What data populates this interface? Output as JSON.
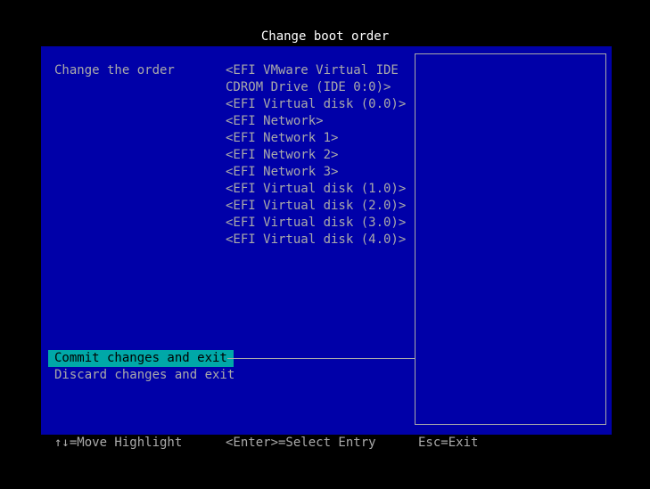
{
  "title": "Change boot order",
  "field_label": "Change the order",
  "boot_entries": [
    "<EFI VMware Virtual IDE CDROM Drive (IDE 0:0)>",
    "<EFI Virtual disk (0.0)>",
    "<EFI Network>",
    "<EFI Network 1>",
    "<EFI Network 2>",
    "<EFI Network 3>",
    "<EFI Virtual disk (1.0)>",
    "<EFI Virtual disk (2.0)>",
    "<EFI Virtual disk (3.0)>",
    "<EFI Virtual disk (4.0)>"
  ],
  "actions": {
    "commit": "Commit changes and exit",
    "discard": "Discard changes and exit"
  },
  "footer": {
    "move": "↑↓=Move Highlight",
    "select": "<Enter>=Select Entry",
    "exit": "Esc=Exit"
  },
  "colors": {
    "background": "#000000",
    "panel": "#0000a8",
    "text": "#aaaaaa",
    "highlight": "#00a8a8",
    "title": "#ffffff"
  }
}
